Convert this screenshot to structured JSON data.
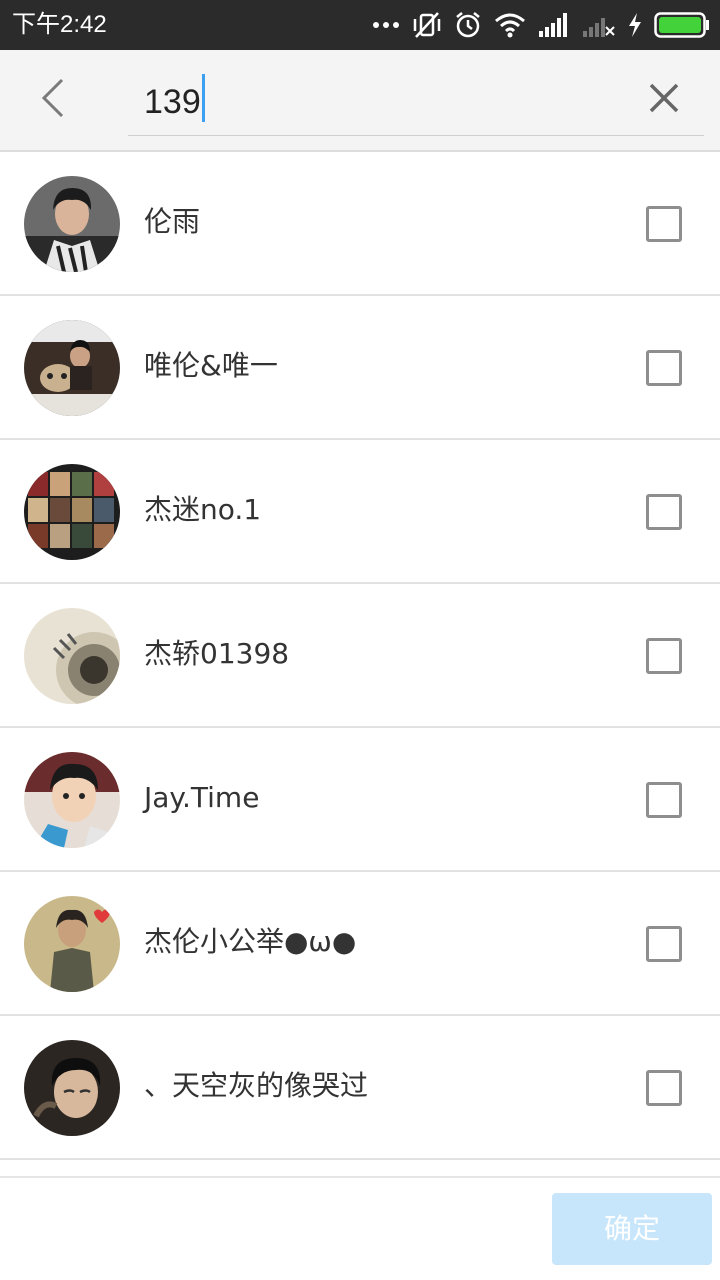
{
  "status_bar": {
    "time": "下午2:42",
    "icons": [
      "more-dots-icon",
      "vibrate-off-icon",
      "alarm-icon",
      "wifi-icon",
      "signal-icon",
      "signal-no-sim-icon",
      "charging-icon",
      "battery-icon"
    ]
  },
  "search": {
    "value": "139",
    "back_icon": "chevron-left-icon",
    "clear_icon": "close-icon"
  },
  "contacts": [
    {
      "name": "伦雨",
      "checked": false
    },
    {
      "name": "唯伦&唯一",
      "checked": false
    },
    {
      "name": "杰迷no.1",
      "checked": false
    },
    {
      "name": "杰轿01398",
      "checked": false
    },
    {
      "name": "Jay.Time",
      "checked": false
    },
    {
      "name": "杰伦小公举●ω●",
      "checked": false
    },
    {
      "name": "、天空灰的像哭过",
      "checked": false
    }
  ],
  "footer": {
    "confirm_label": "确定"
  },
  "colors": {
    "status_bar": "#2b2b2b",
    "header_bg": "#f4f4f4",
    "cursor": "#3ba0f2",
    "confirm_disabled": "#c7e6fb",
    "battery": "#44d23b"
  }
}
